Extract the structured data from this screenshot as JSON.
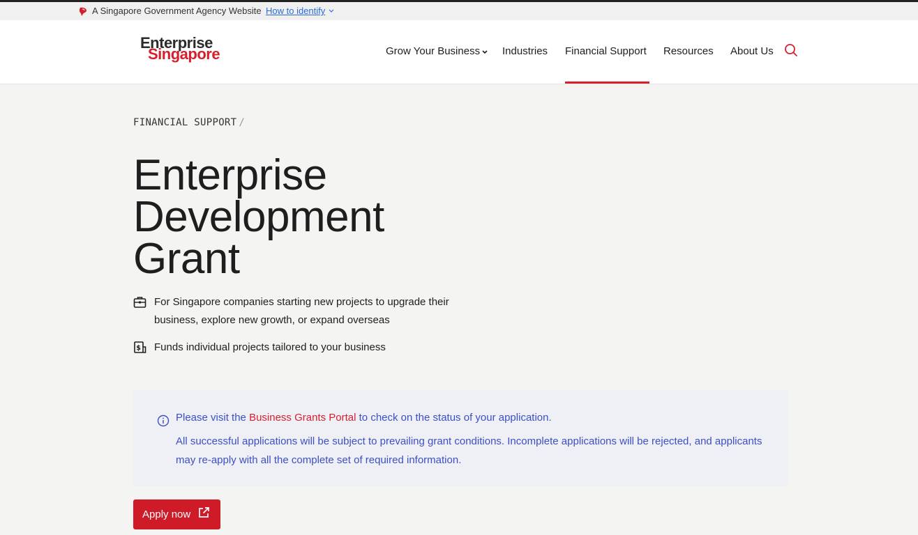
{
  "gov_bar": {
    "text": "A Singapore Government Agency Website",
    "link": "How to identify"
  },
  "logo": {
    "line1": "Enterprise",
    "line2": "Singapore"
  },
  "nav": {
    "items": [
      {
        "label": "Grow Your Business"
      },
      {
        "label": "Industries"
      },
      {
        "label": "Financial Support"
      },
      {
        "label": "Resources"
      },
      {
        "label": "About Us"
      }
    ],
    "active": "Financial Support"
  },
  "breadcrumb": {
    "item": "FINANCIAL SUPPORT",
    "separator": "/"
  },
  "page": {
    "title": "Enterprise Development Grant",
    "features": [
      {
        "icon": "briefcase-icon",
        "text": "For Singapore companies starting new projects to upgrade their business, explore new growth, or expand overseas"
      },
      {
        "icon": "money-icon",
        "text": "Funds individual projects tailored to your business"
      }
    ]
  },
  "notice": {
    "prefix": "Please visit the ",
    "link": "Business Grants Portal",
    "suffix": " to check on the status of your application.",
    "body": "All successful applications will be subject to prevailing grant conditions. Incomplete applications will be rejected, and applicants may re-apply with all the complete set of required information."
  },
  "apply": {
    "label": "Apply now"
  },
  "colors": {
    "brand_red": "#d61f2c",
    "notice_text": "#3d4fc4",
    "notice_bg": "#eef0f6",
    "link_blue": "#2a6bd8"
  }
}
